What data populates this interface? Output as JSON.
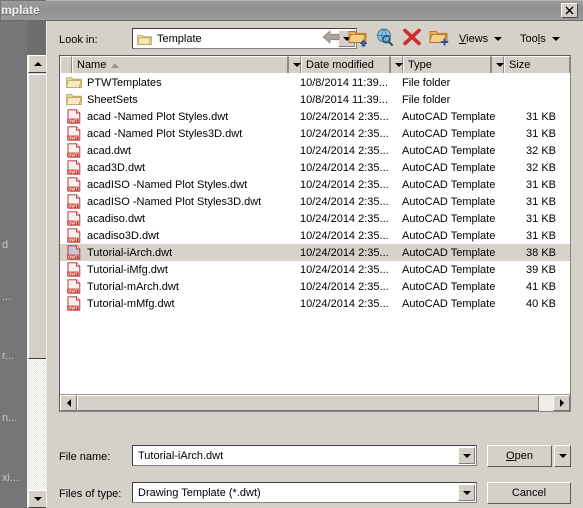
{
  "window": {
    "title": "mplate",
    "close_label": "✕"
  },
  "toolbar": {
    "lookin_label": "Look in:",
    "lookin_value": "Template",
    "icons": [
      {
        "name": "back-arrow-icon",
        "tip": "Back"
      },
      {
        "name": "up-one-level-folder-icon",
        "tip": "Up one level"
      },
      {
        "name": "search-web-icon",
        "tip": "Search the Web"
      },
      {
        "name": "delete-icon",
        "tip": "Delete"
      },
      {
        "name": "new-folder-icon",
        "tip": "Create New Folder"
      }
    ],
    "views_label": "Views",
    "tools_label": "Tools"
  },
  "list": {
    "columns": [
      {
        "key": "name",
        "label": "Name",
        "sorted": "asc",
        "has_dropdown": true
      },
      {
        "key": "date",
        "label": "Date modified",
        "has_dropdown": true
      },
      {
        "key": "type",
        "label": "Type",
        "has_dropdown": true
      },
      {
        "key": "size",
        "label": "Size",
        "has_dropdown": false
      }
    ],
    "rows": [
      {
        "name": "PTWTemplates",
        "date": "10/8/2014 11:39...",
        "type": "File folder",
        "size": "",
        "icon": "folder-icon",
        "selected": false
      },
      {
        "name": "SheetSets",
        "date": "10/8/2014 11:39...",
        "type": "File folder",
        "size": "",
        "icon": "folder-icon",
        "selected": false
      },
      {
        "name": "acad -Named Plot Styles.dwt",
        "date": "10/24/2014 2:35...",
        "type": "AutoCAD Template",
        "size": "31 KB",
        "icon": "dwt-file-icon",
        "selected": false
      },
      {
        "name": "acad -Named Plot Styles3D.dwt",
        "date": "10/24/2014 2:35...",
        "type": "AutoCAD Template",
        "size": "31 KB",
        "icon": "dwt-file-icon",
        "selected": false
      },
      {
        "name": "acad.dwt",
        "date": "10/24/2014 2:35...",
        "type": "AutoCAD Template",
        "size": "32 KB",
        "icon": "dwt-file-icon",
        "selected": false
      },
      {
        "name": "acad3D.dwt",
        "date": "10/24/2014 2:35...",
        "type": "AutoCAD Template",
        "size": "32 KB",
        "icon": "dwt-file-icon",
        "selected": false
      },
      {
        "name": "acadISO -Named Plot Styles.dwt",
        "date": "10/24/2014 2:35...",
        "type": "AutoCAD Template",
        "size": "31 KB",
        "icon": "dwt-file-icon",
        "selected": false
      },
      {
        "name": "acadISO -Named Plot Styles3D.dwt",
        "date": "10/24/2014 2:35...",
        "type": "AutoCAD Template",
        "size": "31 KB",
        "icon": "dwt-file-icon",
        "selected": false
      },
      {
        "name": "acadiso.dwt",
        "date": "10/24/2014 2:35...",
        "type": "AutoCAD Template",
        "size": "31 KB",
        "icon": "dwt-file-icon",
        "selected": false
      },
      {
        "name": "acadiso3D.dwt",
        "date": "10/24/2014 2:35...",
        "type": "AutoCAD Template",
        "size": "31 KB",
        "icon": "dwt-file-icon",
        "selected": false
      },
      {
        "name": "Tutorial-iArch.dwt",
        "date": "10/24/2014 2:35...",
        "type": "AutoCAD Template",
        "size": "38 KB",
        "icon": "dwt-file-icon",
        "selected": true
      },
      {
        "name": "Tutorial-iMfg.dwt",
        "date": "10/24/2014 2:35...",
        "type": "AutoCAD Template",
        "size": "39 KB",
        "icon": "dwt-file-icon",
        "selected": false
      },
      {
        "name": "Tutorial-mArch.dwt",
        "date": "10/24/2014 2:35...",
        "type": "AutoCAD Template",
        "size": "41 KB",
        "icon": "dwt-file-icon",
        "selected": false
      },
      {
        "name": "Tutorial-mMfg.dwt",
        "date": "10/24/2014 2:35...",
        "type": "AutoCAD Template",
        "size": "40 KB",
        "icon": "dwt-file-icon",
        "selected": false
      }
    ]
  },
  "form": {
    "filename_label": "File name:",
    "filename_value": "Tutorial-iArch.dwt",
    "filetype_label": "Files of type:",
    "filetype_value": "Drawing Template (*.dwt)",
    "open_label": "Open",
    "cancel_label": "Cancel"
  },
  "background": {
    "fragments": [
      "d",
      "...",
      "r...",
      "n...",
      "xi..."
    ]
  },
  "colors": {
    "dialog_face": "#d5d1c8",
    "selection": "#d6d2c9",
    "titlebar": "#939393",
    "desktop": "#767676",
    "folder_yellow": "#e8c66a",
    "dwt_red": "#c0392b"
  }
}
